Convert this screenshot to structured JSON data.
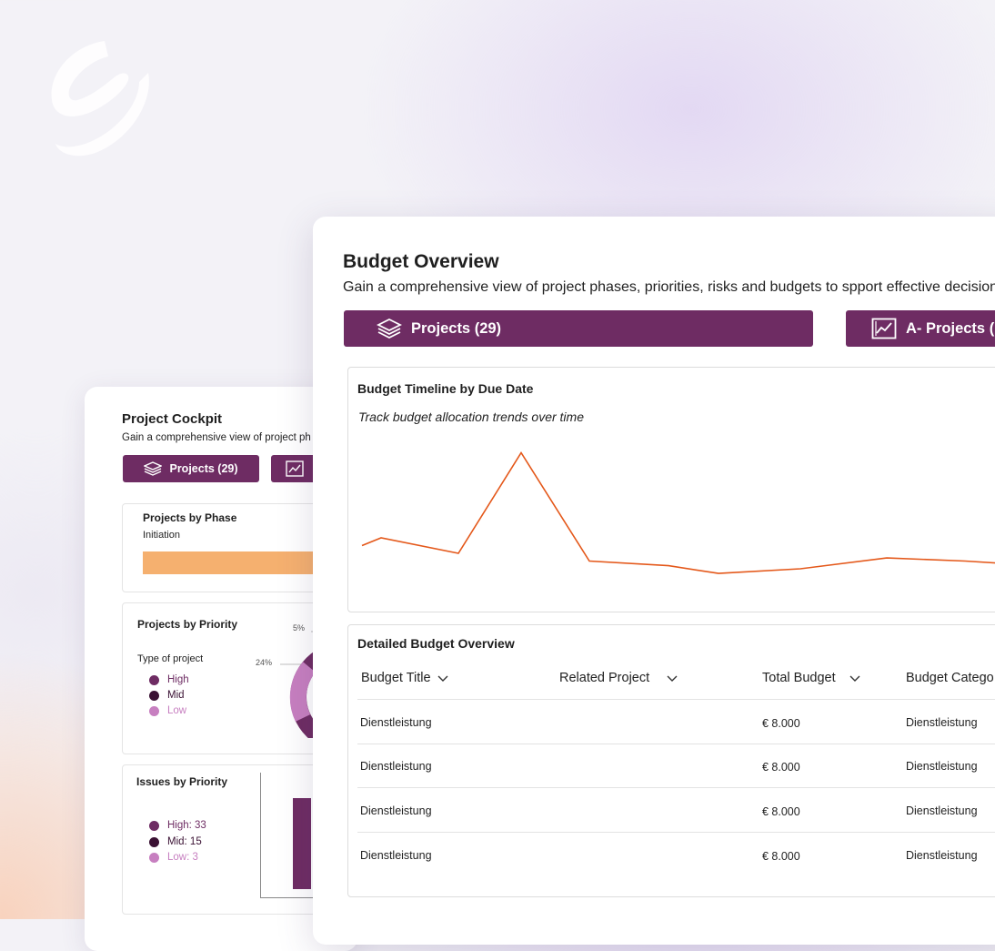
{
  "cockpit": {
    "title": "Project Cockpit",
    "subtitle": "Gain a comprehensive view of project ph",
    "projects_button": "Projects (29)",
    "phase_panel": {
      "title": "Projects by Phase",
      "phase_label": "Initiation",
      "bar_color": "#f5b06f"
    },
    "priority_panel": {
      "title": "Projects by Priority",
      "legend_title": "Type of project",
      "legend": [
        {
          "label": "High",
          "color": "#6e2c63"
        },
        {
          "label": "Mid",
          "color": "#3a1133"
        },
        {
          "label": "Low",
          "color": "#c77fc0"
        }
      ],
      "pct_labels": [
        "5%",
        "24%"
      ]
    },
    "issues_panel": {
      "title": "Issues by Priority",
      "legend": [
        {
          "label": "High: 33",
          "color": "#6e2c63"
        },
        {
          "label": "Mid: 15",
          "color": "#3a1133"
        },
        {
          "label": "Low: 3",
          "color": "#c77fc0"
        }
      ]
    }
  },
  "budget": {
    "title": "Budget Overview",
    "subtitle": "Gain a comprehensive view of project phases, priorities, risks and budgets to spport effective decision-",
    "buttons": [
      "Projects (29)",
      "A- Projects ("
    ],
    "timeline": {
      "title": "Budget Timeline by Due Date",
      "subtitle": "Track budget allocation trends over time",
      "line_color": "#e4581a"
    },
    "table": {
      "title": "Detailed Budget Overview",
      "headers": [
        "Budget Title",
        "Related Project",
        "Total Budget",
        "Budget Catego"
      ],
      "rows": [
        [
          "Dienstleistung",
          "",
          "€ 8.000",
          "Dienstleistung"
        ],
        [
          "Dienstleistung",
          "",
          "€ 8.000",
          "Dienstleistung"
        ],
        [
          "Dienstleistung",
          "",
          "€ 8.000",
          "Dienstleistung"
        ],
        [
          "Dienstleistung",
          "",
          "€ 8.000",
          "Dienstleistung"
        ]
      ]
    }
  },
  "chart_data": {
    "type": "line",
    "title": "Budget Timeline by Due Date",
    "subtitle": "Track budget allocation trends over time",
    "series": [
      {
        "values": [
          0.35,
          0.4,
          0.3,
          0.95,
          0.25,
          0.22,
          0.17,
          0.2,
          0.27,
          0.25,
          0.22
        ]
      }
    ],
    "grid": false,
    "legend": "none"
  }
}
